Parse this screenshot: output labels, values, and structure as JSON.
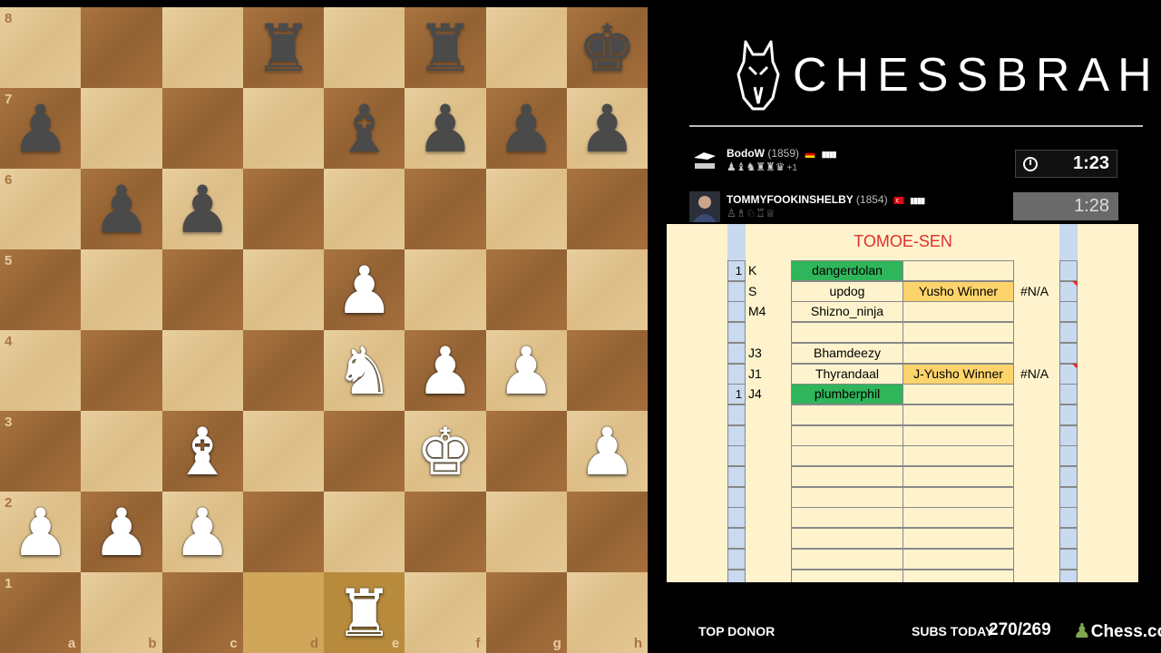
{
  "board": {
    "files": [
      "a",
      "b",
      "c",
      "d",
      "e",
      "f",
      "g",
      "h"
    ],
    "ranks": [
      "8",
      "7",
      "6",
      "5",
      "4",
      "3",
      "2",
      "1"
    ],
    "highlight_squares": [
      "d1",
      "e1"
    ],
    "position": [
      [
        "",
        "",
        "",
        "r",
        "",
        "r",
        "",
        "k"
      ],
      [
        "p",
        "",
        "",
        "",
        "b",
        "p",
        "p",
        "p"
      ],
      [
        "",
        "p",
        "p",
        "",
        "",
        "",
        "",
        ""
      ],
      [
        "",
        "",
        "",
        "",
        "P",
        "",
        "",
        ""
      ],
      [
        "",
        "",
        "",
        "",
        "N",
        "P",
        "P",
        ""
      ],
      [
        "",
        "",
        "B",
        "",
        "",
        "K",
        "",
        "P"
      ],
      [
        "P",
        "P",
        "P",
        "",
        "",
        "",
        "",
        ""
      ],
      [
        "",
        "",
        "",
        "",
        "R",
        "",
        "",
        ""
      ]
    ]
  },
  "logo": {
    "text": "CHESSBRAH",
    "icon": "horse-head-icon"
  },
  "players": {
    "top": {
      "name": "BodoW",
      "rating": "(1859)",
      "flag": "germany-flag",
      "signal": "▮▮▮▮",
      "captured": "♟♝♞♜♜♛",
      "material_diff": "+1",
      "clock": "1:23",
      "clock_active": true
    },
    "bottom": {
      "name": "TOMMYFOOKINSHELBY",
      "rating": "(1854)",
      "flag": "turkey-flag",
      "signal": "▮▮▮▮",
      "captured": "♙♗♘♖♕",
      "clock": "1:28",
      "clock_active": false
    }
  },
  "sheet": {
    "title": "TOMOE-SEN",
    "rows": [
      {
        "num": "1",
        "code": "K",
        "name": "dangerdolan",
        "name_style": "green",
        "winner": "",
        "winner_style": "",
        "na": ""
      },
      {
        "num": "",
        "code": "S",
        "name": "updog",
        "name_style": "",
        "winner": "Yusho Winner",
        "winner_style": "yellow",
        "na": "#N/A"
      },
      {
        "num": "",
        "code": "M4",
        "name": "Shizno_ninja",
        "name_style": "",
        "winner": "",
        "winner_style": "",
        "na": ""
      },
      {
        "num": "",
        "code": "",
        "name": "",
        "name_style": "",
        "winner": "",
        "winner_style": "",
        "na": ""
      },
      {
        "num": "",
        "code": "J3",
        "name": "Bhamdeezy",
        "name_style": "",
        "winner": "",
        "winner_style": "",
        "na": ""
      },
      {
        "num": "",
        "code": "J1",
        "name": "Thyrandaal",
        "name_style": "",
        "winner": "J-Yusho Winner",
        "winner_style": "yellow",
        "na": "#N/A"
      },
      {
        "num": "1",
        "code": "J4",
        "name": "plumberphil",
        "name_style": "green",
        "winner": "",
        "winner_style": "",
        "na": ""
      },
      {
        "num": "",
        "code": "",
        "name": "",
        "name_style": "",
        "winner": "",
        "winner_style": "",
        "na": ""
      },
      {
        "num": "",
        "code": "",
        "name": "",
        "name_style": "",
        "winner": "",
        "winner_style": "",
        "na": ""
      },
      {
        "num": "",
        "code": "",
        "name": "",
        "name_style": "",
        "winner": "",
        "winner_style": "",
        "na": ""
      },
      {
        "num": "",
        "code": "",
        "name": "",
        "name_style": "",
        "winner": "",
        "winner_style": "",
        "na": ""
      },
      {
        "num": "",
        "code": "",
        "name": "",
        "name_style": "",
        "winner": "",
        "winner_style": "",
        "na": ""
      },
      {
        "num": "",
        "code": "",
        "name": "",
        "name_style": "",
        "winner": "",
        "winner_style": "",
        "na": ""
      },
      {
        "num": "",
        "code": "",
        "name": "",
        "name_style": "",
        "winner": "",
        "winner_style": "",
        "na": ""
      },
      {
        "num": "",
        "code": "",
        "name": "",
        "name_style": "",
        "winner": "",
        "winner_style": "",
        "na": ""
      },
      {
        "num": "",
        "code": "",
        "name": "",
        "name_style": "",
        "winner": "",
        "winner_style": "",
        "na": ""
      }
    ]
  },
  "footer": {
    "top_donor_label": "TOP DONOR",
    "subs_label": "SUBS TODAY",
    "subs_value": "270/269",
    "sponsor": "Chess.com",
    "sponsor_icon": "chess-pawn-icon"
  },
  "colors": {
    "light_square": "#e8cf9f",
    "dark_square": "#a9743f",
    "sheet_bg": "#fef3cd",
    "green_cell": "#2fb55a",
    "yellow_cell": "#fdd46b",
    "title_red": "#e0302a"
  }
}
